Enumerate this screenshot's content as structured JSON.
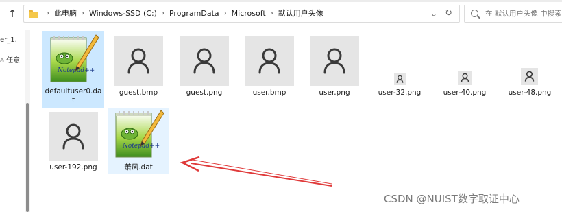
{
  "breadcrumb": {
    "parts": [
      "此电脑",
      "Windows-SSD (C:)",
      "ProgramData",
      "Microsoft",
      "默认用户头像"
    ],
    "separator": "›"
  },
  "nav": {
    "up_icon": "up-arrow-icon"
  },
  "search": {
    "placeholder": "在 默认用户头像 中搜索"
  },
  "sidebar": {
    "fragment1": "er_1.",
    "fragment2": "a 任意"
  },
  "files": [
    {
      "name": "defaultuser0.dat",
      "display": "defaultuser0.da\nt",
      "icon": "notepad-plus-plus-icon",
      "selected": true
    },
    {
      "name": "guest.bmp",
      "icon": "person-icon"
    },
    {
      "name": "guest.png",
      "icon": "person-icon"
    },
    {
      "name": "user.bmp",
      "icon": "person-icon"
    },
    {
      "name": "user.png",
      "icon": "person-icon"
    },
    {
      "name": "user-32.png",
      "icon": "person-icon"
    },
    {
      "name": "user-40.png",
      "icon": "person-icon"
    },
    {
      "name": "user-48.png",
      "icon": "person-icon"
    },
    {
      "name": "user-192.png",
      "icon": "person-icon"
    },
    {
      "name": "萧风.dat",
      "icon": "notepad-plus-plus-icon",
      "hovered": true
    }
  ],
  "annotation": {
    "arrow_color": "#e03a3a"
  },
  "watermark": "CSDN @NUIST数字取证中心",
  "colors": {
    "selection": "#cce8ff",
    "hover": "#e5f3ff",
    "thumb_bg": "#e5e5e5"
  }
}
